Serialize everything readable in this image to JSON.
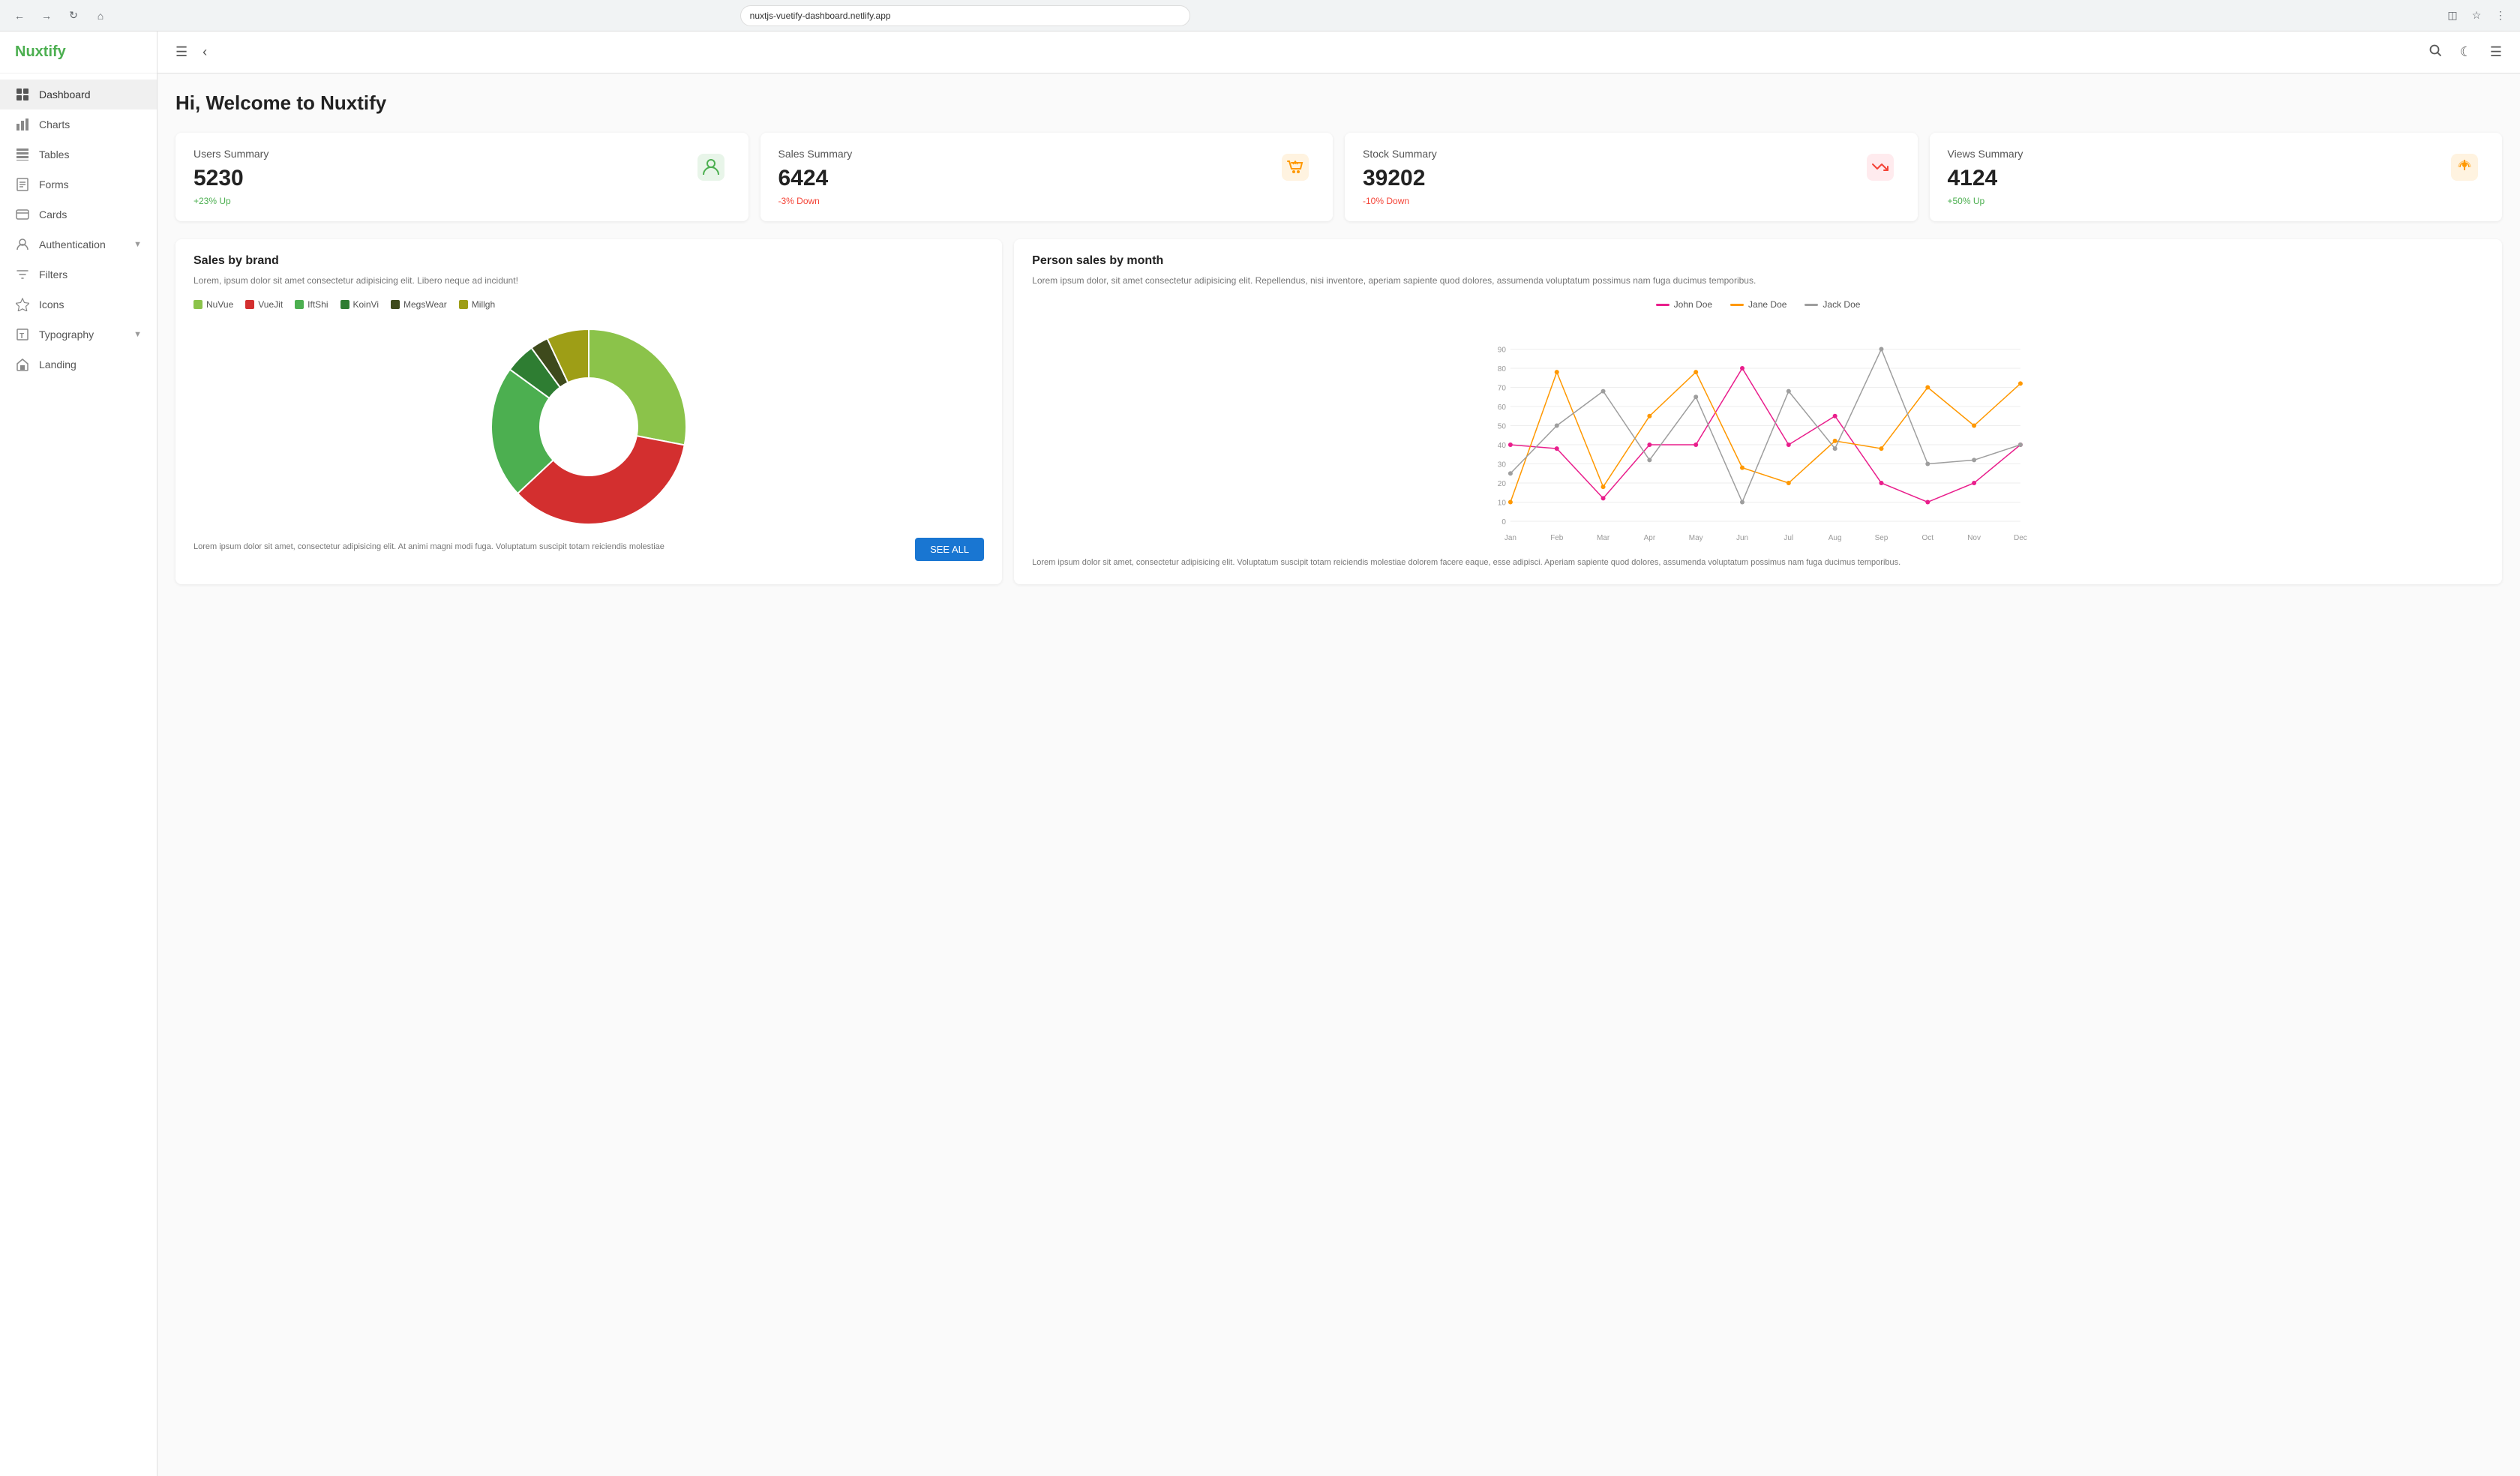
{
  "browser": {
    "url": "nuxtjs-vuetify-dashboard.netlify.app"
  },
  "sidebar": {
    "logo": "Nuxtify",
    "items": [
      {
        "id": "dashboard",
        "label": "Dashboard",
        "icon": "⊞",
        "active": true
      },
      {
        "id": "charts",
        "label": "Charts",
        "icon": "📊",
        "active": false
      },
      {
        "id": "tables",
        "label": "Tables",
        "icon": "⊟",
        "active": false
      },
      {
        "id": "forms",
        "label": "Forms",
        "icon": "📋",
        "active": false
      },
      {
        "id": "cards",
        "label": "Cards",
        "icon": "🃏",
        "active": false
      },
      {
        "id": "authentication",
        "label": "Authentication",
        "icon": "👤",
        "active": false,
        "has_chevron": true
      },
      {
        "id": "filters",
        "label": "Filters",
        "icon": "🏷",
        "active": false
      },
      {
        "id": "icons",
        "label": "Icons",
        "icon": "★",
        "active": false
      },
      {
        "id": "typography",
        "label": "Typography",
        "icon": "📄",
        "active": false,
        "has_chevron": true
      },
      {
        "id": "landing",
        "label": "Landing",
        "icon": "🏠",
        "active": false
      }
    ]
  },
  "header": {
    "welcome": "Hi, Welcome to Nuxtify"
  },
  "summary_cards": [
    {
      "label": "Users Summary",
      "value": "5230",
      "change": "+23% Up",
      "change_dir": "up",
      "icon": "👤",
      "icon_color": "#4caf50",
      "icon_bg": "#e8f5e9"
    },
    {
      "label": "Sales Summary",
      "value": "6424",
      "change": "-3% Down",
      "change_dir": "down",
      "icon": "🛒",
      "icon_color": "#ff9800",
      "icon_bg": "#fff3e0"
    },
    {
      "label": "Stock Summary",
      "value": "39202",
      "change": "-10% Down",
      "change_dir": "down",
      "icon": "📈",
      "icon_color": "#f44336",
      "icon_bg": "#ffebee"
    },
    {
      "label": "Views Summary",
      "value": "4124",
      "change": "+50% Up",
      "change_dir": "up",
      "icon": "👆",
      "icon_color": "#ff9800",
      "icon_bg": "#fff3e0"
    }
  ],
  "donut_chart": {
    "title": "Sales by brand",
    "description": "Lorem, ipsum dolor sit amet consectetur adipisicing elit. Libero neque ad incidunt!",
    "footer_text": "Lorem ipsum dolor sit amet, consectetur adipisicing elit. At animi magni modi fuga. Voluptatum suscipit totam reiciendis molestiae",
    "see_all_label": "SEE ALL",
    "legend": [
      {
        "label": "NuVue",
        "color": "#8bc34a"
      },
      {
        "label": "VueJit",
        "color": "#d32f2f"
      },
      {
        "label": "IftShi",
        "color": "#4caf50"
      },
      {
        "label": "KoinVi",
        "color": "#2e7d32"
      },
      {
        "label": "MegsWear",
        "color": "#3e4a1c"
      },
      {
        "label": "Millgh",
        "color": "#9e9e16"
      }
    ],
    "segments": [
      {
        "label": "NuVue",
        "color": "#8bc34a",
        "percent": 28
      },
      {
        "label": "VueJit",
        "color": "#d32f2f",
        "percent": 35
      },
      {
        "label": "IftShi",
        "color": "#4caf50",
        "percent": 22
      },
      {
        "label": "KoinVi",
        "color": "#2e7d32",
        "percent": 5
      },
      {
        "label": "MegsWear",
        "color": "#3e4a1c",
        "percent": 3
      },
      {
        "label": "Millgh",
        "color": "#9e9e16",
        "percent": 7
      }
    ]
  },
  "line_chart": {
    "title": "Person sales by month",
    "description": "Lorem ipsum dolor, sit amet consectetur adipisicing elit. Repellendus, nisi inventore, aperiam sapiente quod dolores, assumenda voluptatum possimus nam fuga ducimus temporibus.",
    "footer_text": "Lorem ipsum dolor sit amet, consectetur adipisicing elit. Voluptatum suscipit totam reiciendis molestiae dolorem facere eaque, esse adipisci. Aperiam sapiente quod dolores, assumenda voluptatum possimus nam fuga ducimus temporibus.",
    "legend": [
      {
        "label": "John Doe",
        "color": "#e91e8c"
      },
      {
        "label": "Jane Doe",
        "color": "#ff9800"
      },
      {
        "label": "Jack Doe",
        "color": "#9e9e9e"
      }
    ],
    "months": [
      "Jan",
      "Feb",
      "Mar",
      "Apr",
      "May",
      "Jun",
      "Jul",
      "Aug",
      "Sep",
      "Oct",
      "Nov",
      "Dec"
    ],
    "series": {
      "john": [
        40,
        38,
        12,
        40,
        40,
        80,
        40,
        55,
        20,
        10,
        20,
        40
      ],
      "jane": [
        10,
        78,
        18,
        55,
        78,
        28,
        20,
        42,
        38,
        70,
        50,
        72
      ],
      "jack": [
        25,
        50,
        68,
        32,
        65,
        10,
        68,
        38,
        90,
        30,
        32,
        40
      ]
    }
  }
}
